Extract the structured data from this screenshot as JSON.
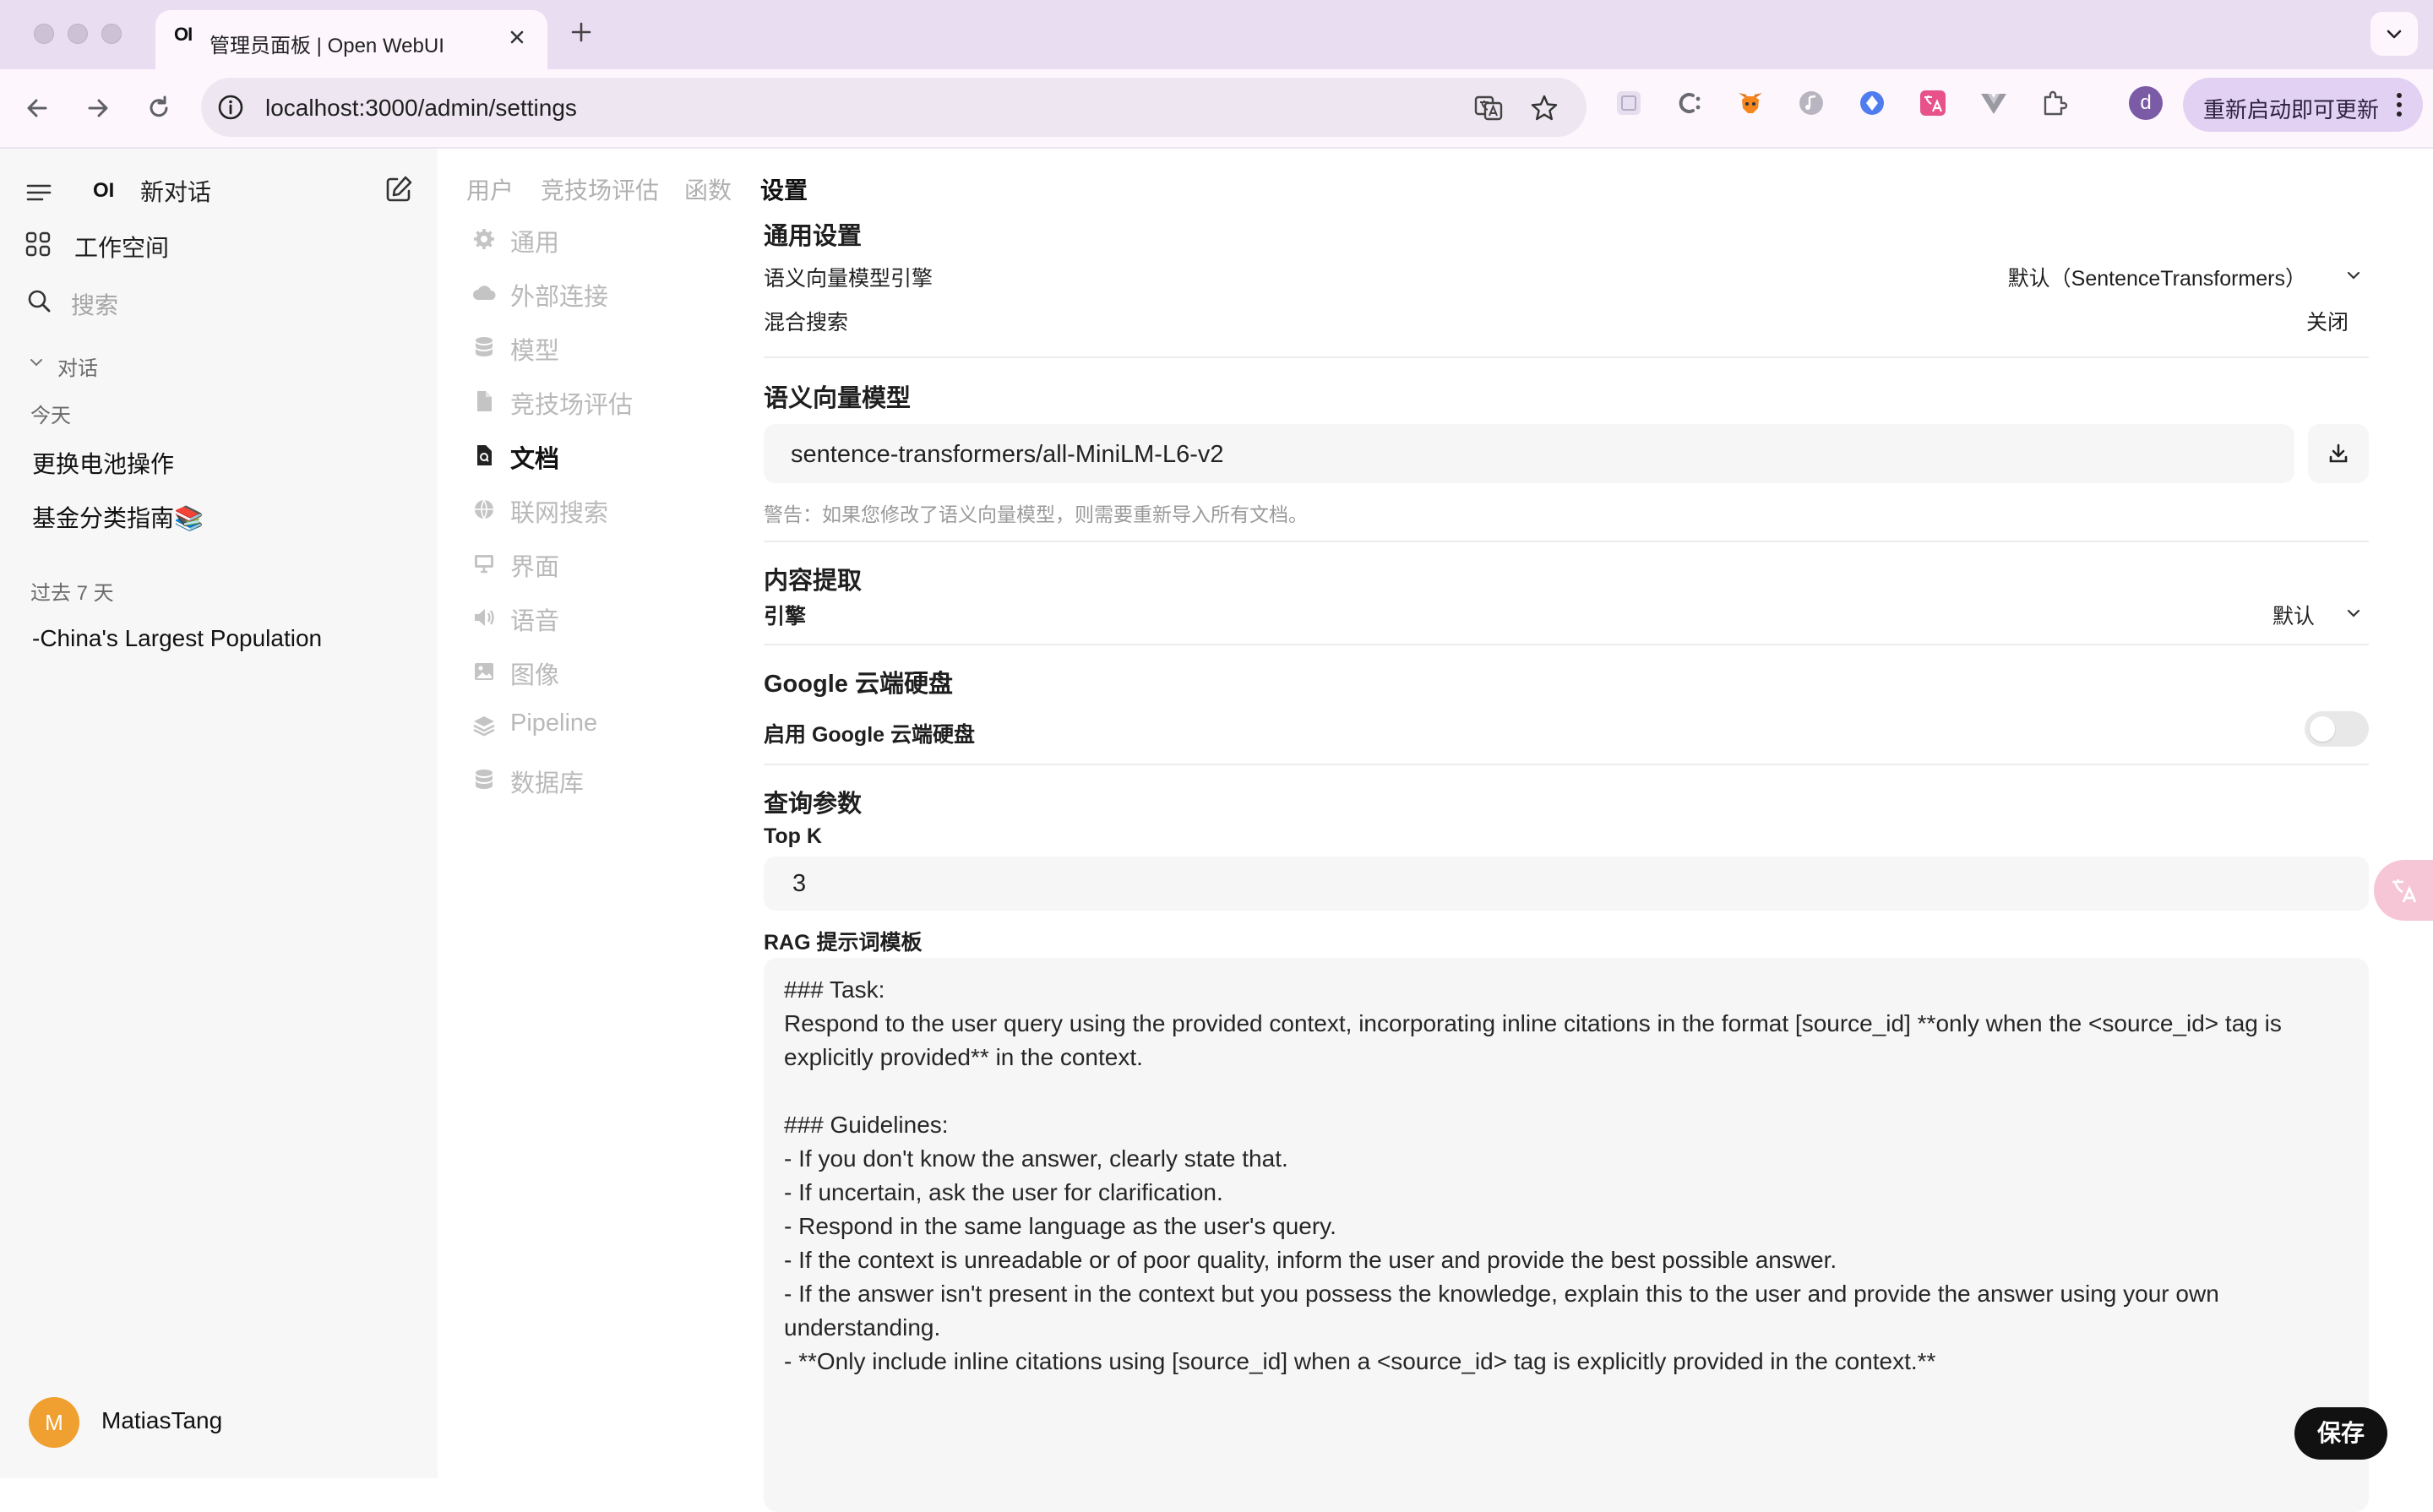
{
  "browser": {
    "tab_title": "管理员面板 | Open WebUI",
    "tab_favicon": "OI",
    "url": "localhost:3000/admin/settings",
    "update_button": "重新启动即可更新",
    "profile_initial": "d"
  },
  "sidebar": {
    "logo": "OI",
    "new_chat": "新对话",
    "workspace": "工作空间",
    "search_placeholder": "搜索",
    "folder": "对话",
    "today_label": "今天",
    "today_chats": [
      "更换电池操作",
      "基金分类指南📚"
    ],
    "past7_label": "过去 7 天",
    "past7_chats": [
      "-China's Largest Population"
    ],
    "user_initial": "M",
    "user_name": "MatiasTang"
  },
  "admin": {
    "top_tabs": [
      "用户",
      "竞技场评估",
      "函数",
      "设置"
    ],
    "active_top_tab": "设置",
    "settings_nav": [
      "通用",
      "外部连接",
      "模型",
      "竞技场评估",
      "文档",
      "联网搜索",
      "界面",
      "语音",
      "图像",
      "Pipeline",
      "数据库"
    ],
    "active_settings_nav": "文档"
  },
  "documents": {
    "general_heading": "通用设置",
    "embedding_engine_label": "语义向量模型引擎",
    "embedding_engine_value": "默认（SentenceTransformers）",
    "hybrid_search_label": "混合搜索",
    "hybrid_search_value": "关闭",
    "embedding_model_heading": "语义向量模型",
    "embedding_model_value": "sentence-transformers/all-MiniLM-L6-v2",
    "embedding_warning": "警告：如果您修改了语义向量模型，则需要重新导入所有文档。",
    "content_extraction_heading": "内容提取",
    "engine_label": "引擎",
    "engine_value": "默认",
    "gdrive_heading": "Google 云端硬盘",
    "gdrive_toggle_label": "启用 Google 云端硬盘",
    "gdrive_enabled": false,
    "query_heading": "查询参数",
    "topk_label": "Top K",
    "topk_value": "3",
    "rag_template_label": "RAG 提示词模板",
    "rag_template": "### Task:\nRespond to the user query using the provided context, incorporating inline citations in the format [source_id] **only when the <source_id> tag is explicitly provided** in the context.\n\n### Guidelines:\n- If you don't know the answer, clearly state that.\n- If uncertain, ask the user for clarification.\n- Respond in the same language as the user's query.\n- If the context is unreadable or of poor quality, inform the user and provide the best possible answer.\n- If the answer isn't present in the context but you possess the knowledge, explain this to the user and provide the answer using your own understanding.\n- **Only include inline citations using [source_id] when a <source_id> tag is explicitly provided in the context.**",
    "save_button": "保存"
  }
}
